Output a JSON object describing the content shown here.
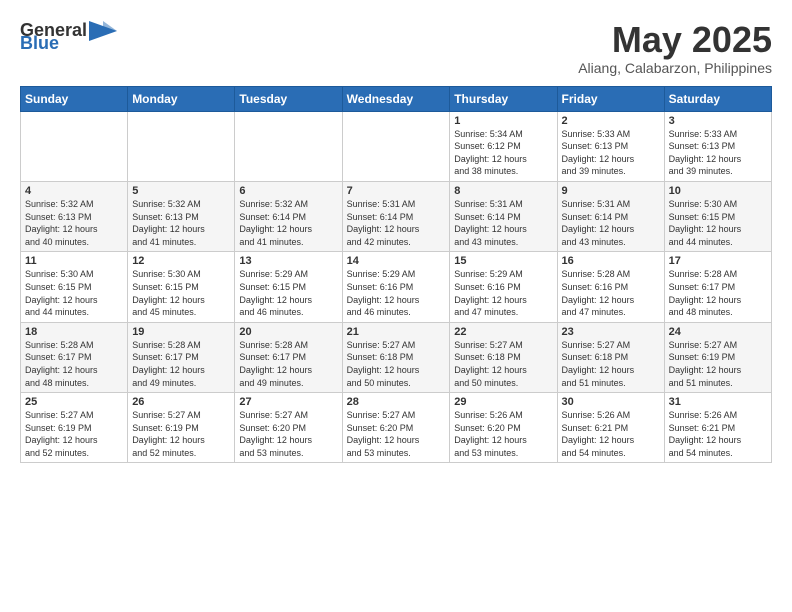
{
  "header": {
    "logo_general": "General",
    "logo_blue": "Blue",
    "title": "May 2025",
    "subtitle": "Aliang, Calabarzon, Philippines"
  },
  "days_of_week": [
    "Sunday",
    "Monday",
    "Tuesday",
    "Wednesday",
    "Thursday",
    "Friday",
    "Saturday"
  ],
  "weeks": [
    [
      {
        "day": "",
        "info": ""
      },
      {
        "day": "",
        "info": ""
      },
      {
        "day": "",
        "info": ""
      },
      {
        "day": "",
        "info": ""
      },
      {
        "day": "1",
        "info": "Sunrise: 5:34 AM\nSunset: 6:12 PM\nDaylight: 12 hours\nand 38 minutes."
      },
      {
        "day": "2",
        "info": "Sunrise: 5:33 AM\nSunset: 6:13 PM\nDaylight: 12 hours\nand 39 minutes."
      },
      {
        "day": "3",
        "info": "Sunrise: 5:33 AM\nSunset: 6:13 PM\nDaylight: 12 hours\nand 39 minutes."
      }
    ],
    [
      {
        "day": "4",
        "info": "Sunrise: 5:32 AM\nSunset: 6:13 PM\nDaylight: 12 hours\nand 40 minutes."
      },
      {
        "day": "5",
        "info": "Sunrise: 5:32 AM\nSunset: 6:13 PM\nDaylight: 12 hours\nand 41 minutes."
      },
      {
        "day": "6",
        "info": "Sunrise: 5:32 AM\nSunset: 6:14 PM\nDaylight: 12 hours\nand 41 minutes."
      },
      {
        "day": "7",
        "info": "Sunrise: 5:31 AM\nSunset: 6:14 PM\nDaylight: 12 hours\nand 42 minutes."
      },
      {
        "day": "8",
        "info": "Sunrise: 5:31 AM\nSunset: 6:14 PM\nDaylight: 12 hours\nand 43 minutes."
      },
      {
        "day": "9",
        "info": "Sunrise: 5:31 AM\nSunset: 6:14 PM\nDaylight: 12 hours\nand 43 minutes."
      },
      {
        "day": "10",
        "info": "Sunrise: 5:30 AM\nSunset: 6:15 PM\nDaylight: 12 hours\nand 44 minutes."
      }
    ],
    [
      {
        "day": "11",
        "info": "Sunrise: 5:30 AM\nSunset: 6:15 PM\nDaylight: 12 hours\nand 44 minutes."
      },
      {
        "day": "12",
        "info": "Sunrise: 5:30 AM\nSunset: 6:15 PM\nDaylight: 12 hours\nand 45 minutes."
      },
      {
        "day": "13",
        "info": "Sunrise: 5:29 AM\nSunset: 6:15 PM\nDaylight: 12 hours\nand 46 minutes."
      },
      {
        "day": "14",
        "info": "Sunrise: 5:29 AM\nSunset: 6:16 PM\nDaylight: 12 hours\nand 46 minutes."
      },
      {
        "day": "15",
        "info": "Sunrise: 5:29 AM\nSunset: 6:16 PM\nDaylight: 12 hours\nand 47 minutes."
      },
      {
        "day": "16",
        "info": "Sunrise: 5:28 AM\nSunset: 6:16 PM\nDaylight: 12 hours\nand 47 minutes."
      },
      {
        "day": "17",
        "info": "Sunrise: 5:28 AM\nSunset: 6:17 PM\nDaylight: 12 hours\nand 48 minutes."
      }
    ],
    [
      {
        "day": "18",
        "info": "Sunrise: 5:28 AM\nSunset: 6:17 PM\nDaylight: 12 hours\nand 48 minutes."
      },
      {
        "day": "19",
        "info": "Sunrise: 5:28 AM\nSunset: 6:17 PM\nDaylight: 12 hours\nand 49 minutes."
      },
      {
        "day": "20",
        "info": "Sunrise: 5:28 AM\nSunset: 6:17 PM\nDaylight: 12 hours\nand 49 minutes."
      },
      {
        "day": "21",
        "info": "Sunrise: 5:27 AM\nSunset: 6:18 PM\nDaylight: 12 hours\nand 50 minutes."
      },
      {
        "day": "22",
        "info": "Sunrise: 5:27 AM\nSunset: 6:18 PM\nDaylight: 12 hours\nand 50 minutes."
      },
      {
        "day": "23",
        "info": "Sunrise: 5:27 AM\nSunset: 6:18 PM\nDaylight: 12 hours\nand 51 minutes."
      },
      {
        "day": "24",
        "info": "Sunrise: 5:27 AM\nSunset: 6:19 PM\nDaylight: 12 hours\nand 51 minutes."
      }
    ],
    [
      {
        "day": "25",
        "info": "Sunrise: 5:27 AM\nSunset: 6:19 PM\nDaylight: 12 hours\nand 52 minutes."
      },
      {
        "day": "26",
        "info": "Sunrise: 5:27 AM\nSunset: 6:19 PM\nDaylight: 12 hours\nand 52 minutes."
      },
      {
        "day": "27",
        "info": "Sunrise: 5:27 AM\nSunset: 6:20 PM\nDaylight: 12 hours\nand 53 minutes."
      },
      {
        "day": "28",
        "info": "Sunrise: 5:27 AM\nSunset: 6:20 PM\nDaylight: 12 hours\nand 53 minutes."
      },
      {
        "day": "29",
        "info": "Sunrise: 5:26 AM\nSunset: 6:20 PM\nDaylight: 12 hours\nand 53 minutes."
      },
      {
        "day": "30",
        "info": "Sunrise: 5:26 AM\nSunset: 6:21 PM\nDaylight: 12 hours\nand 54 minutes."
      },
      {
        "day": "31",
        "info": "Sunrise: 5:26 AM\nSunset: 6:21 PM\nDaylight: 12 hours\nand 54 minutes."
      }
    ]
  ]
}
